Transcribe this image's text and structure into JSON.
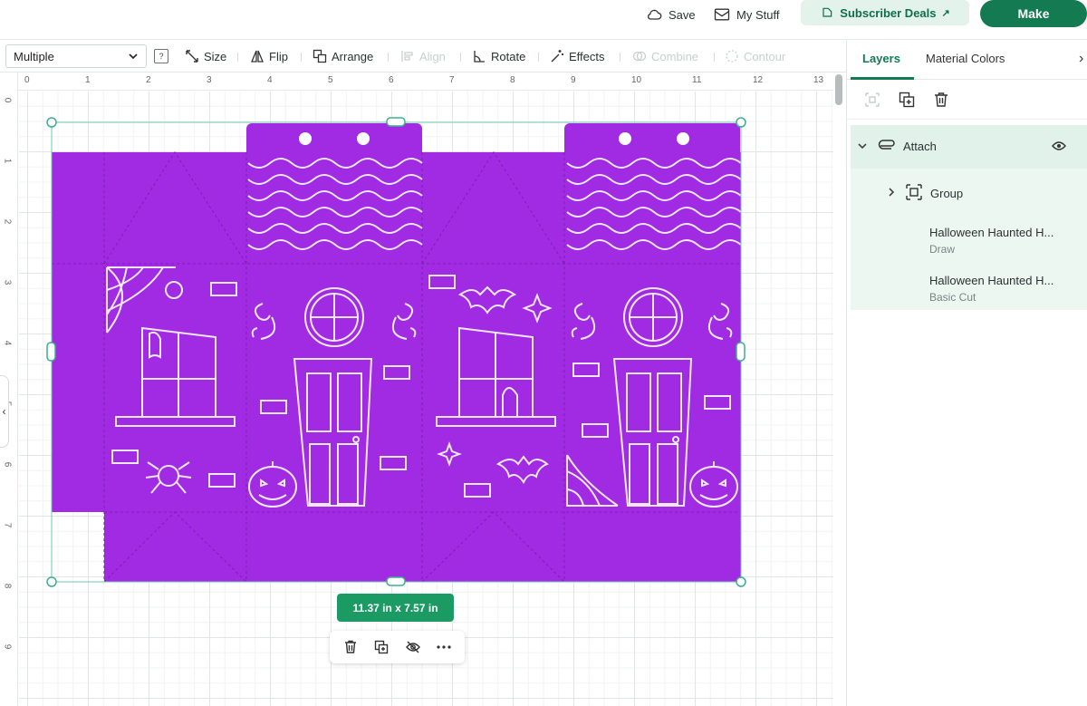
{
  "topbar": {
    "save": "Save",
    "my_stuff": "My Stuff",
    "subscriber_deals": "Subscriber Deals",
    "deals_arrow": "↗",
    "make": "Make"
  },
  "toolbar": {
    "select_value": "Multiple",
    "help": "?",
    "size": "Size",
    "flip": "Flip",
    "arrange": "Arrange",
    "align": "Align",
    "rotate": "Rotate",
    "effects": "Effects",
    "combine": "Combine",
    "contour": "Contour"
  },
  "ruler": {
    "top": [
      "0",
      "1",
      "2",
      "3",
      "4",
      "5",
      "6",
      "7",
      "8",
      "9",
      "10",
      "11",
      "12",
      "13"
    ],
    "left": [
      "0",
      "1",
      "2",
      "3",
      "4",
      "5",
      "6",
      "7",
      "8",
      "9"
    ]
  },
  "canvas": {
    "size_badge": "11.37  in x 7.57  in",
    "design_color": "#a02be3",
    "line_color": "#f3e8fb"
  },
  "panel": {
    "tab_layers": "Layers",
    "tab_material": "Material Colors",
    "close": "›",
    "attach_label": "Attach",
    "group_label": "Group",
    "layer1_name": "Halloween Haunted H...",
    "layer1_type": "Draw",
    "layer2_name": "Halloween Haunted H...",
    "layer2_type": "Basic Cut"
  },
  "left_tab_glyph": "‹",
  "colors": {
    "accent": "#147a52",
    "badge": "#1c9a64",
    "selection": "#6fc7b2"
  }
}
